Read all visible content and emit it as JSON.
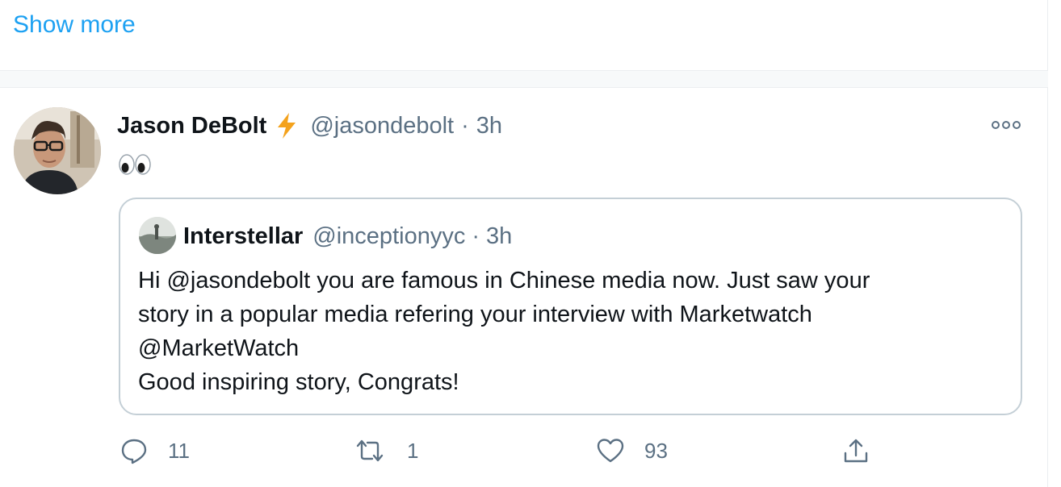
{
  "show_more": {
    "label": "Show more"
  },
  "tweet": {
    "author_name": "Jason DeBolt",
    "author_badge_icon": "lightning-bolt-icon",
    "author_handle": "@jasondebolt",
    "separator": "·",
    "time": "3h",
    "body_emoji_icon": "eyes-emoji-icon",
    "quoted": {
      "author_name": "Interstellar",
      "author_handle": "@inceptionyyc",
      "separator": "·",
      "time": "3h",
      "lines": [
        "Hi @jasondebolt you are famous in Chinese media now. Just saw your",
        "story in a popular media refering your interview with Marketwatch",
        "@MarketWatch",
        "Good inspiring story, Congrats!"
      ]
    },
    "actions": {
      "reply_count": "11",
      "retweet_count": "1",
      "like_count": "93"
    }
  },
  "colors": {
    "link": "#1da1f2",
    "text_primary": "#0f1419",
    "text_secondary": "#5b7083",
    "border": "#c4cfd6",
    "bolt": "#f4a21c"
  }
}
